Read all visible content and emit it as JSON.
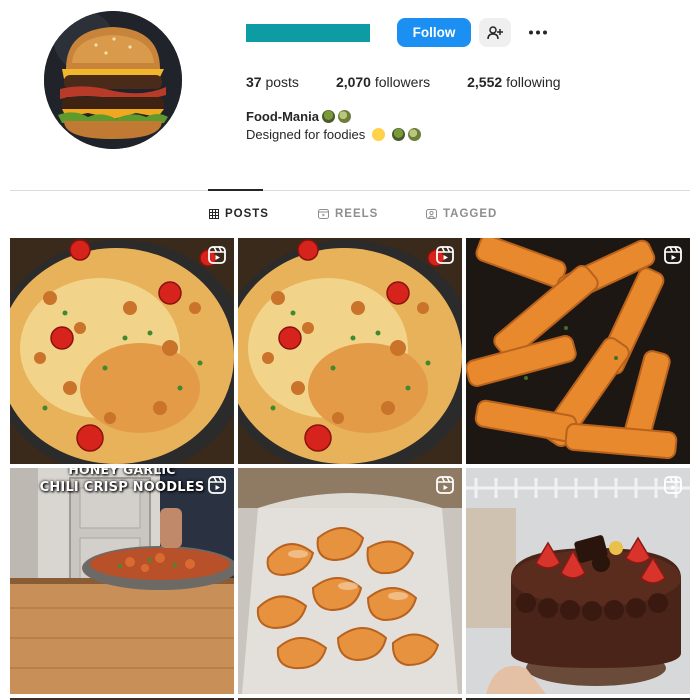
{
  "profile": {
    "display_name": "Food-Mania",
    "bio": "Designed for foodies",
    "brand_color": "#0d9ca3"
  },
  "actions": {
    "follow_label": "Follow",
    "follow_color": "#1b8ff2",
    "add_user_icon": "add-user-icon",
    "more_icon": "more-icon"
  },
  "stats": [
    {
      "value": "37",
      "label": "posts"
    },
    {
      "value": "2,070",
      "label": "followers"
    },
    {
      "value": "2,552",
      "label": "following"
    }
  ],
  "tabs": [
    {
      "label": "POSTS",
      "icon": "grid-icon",
      "active": true
    },
    {
      "label": "REELS",
      "icon": "reels-icon",
      "active": false
    },
    {
      "label": "TAGGED",
      "icon": "tagged-icon",
      "active": false
    }
  ],
  "posts": [
    {
      "subject": "cheesy pasta skillet",
      "is_reel": true
    },
    {
      "subject": "cheesy pasta skillet",
      "is_reel": true
    },
    {
      "subject": "orange penne pasta",
      "is_reel": true
    },
    {
      "subject": "chili crisp noodles",
      "is_reel": true,
      "overlay_lines": [
        "HONEY GARLIC",
        "CHILI CRISP NOODLES"
      ]
    },
    {
      "subject": "fried shrimp in bag",
      "is_reel": true
    },
    {
      "subject": "chocolate strawberry cake",
      "is_reel": true
    }
  ]
}
